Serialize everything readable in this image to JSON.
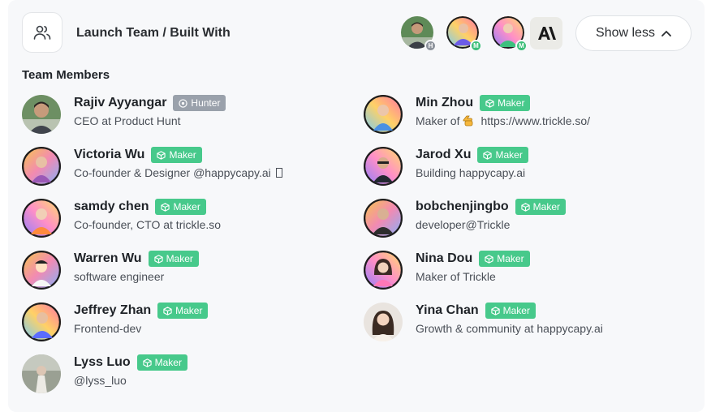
{
  "header": {
    "title": "Launch Team / Built With",
    "show_less_label": "Show less",
    "avatars": [
      {
        "role_letter": "H",
        "role": "hunter"
      },
      {
        "role_letter": "M",
        "role": "maker"
      },
      {
        "role_letter": "M",
        "role": "maker"
      }
    ],
    "brand_mark": "A\\"
  },
  "section": {
    "title": "Team Members"
  },
  "members": [
    {
      "name": "Rajiv Ayyangar",
      "badge": "Hunter",
      "desc": "CEO at Product Hunt"
    },
    {
      "name": "Min Zhou",
      "badge": "Maker",
      "desc_prefix": "Maker of",
      "desc_link": "https://www.trickle.so/"
    },
    {
      "name": "Victoria Wu",
      "badge": "Maker",
      "desc": "Co-founder & Designer @happycapy.ai"
    },
    {
      "name": "Jarod Xu",
      "badge": "Maker",
      "desc": "Building happycapy.ai"
    },
    {
      "name": "samdy chen",
      "badge": "Maker",
      "desc": "Co-founder, CTO at trickle.so"
    },
    {
      "name": "bobchenjingbo",
      "badge": "Maker",
      "desc": "developer@Trickle"
    },
    {
      "name": "Warren Wu",
      "badge": "Maker",
      "desc": "software engineer"
    },
    {
      "name": "Nina Dou",
      "badge": "Maker",
      "desc": "Maker of Trickle"
    },
    {
      "name": "Jeffrey Zhan",
      "badge": "Maker",
      "desc": "Frontend-dev"
    },
    {
      "name": "Yina Chan",
      "badge": "Maker",
      "desc": "Growth & community at happycapy.ai"
    },
    {
      "name": "Lyss Luo",
      "badge": "Maker",
      "desc": "@lyss_luo"
    }
  ],
  "colors": {
    "maker_badge": "#47c98b",
    "hunter_badge": "#9aa1ab",
    "card_bg": "#f7f8fa"
  }
}
